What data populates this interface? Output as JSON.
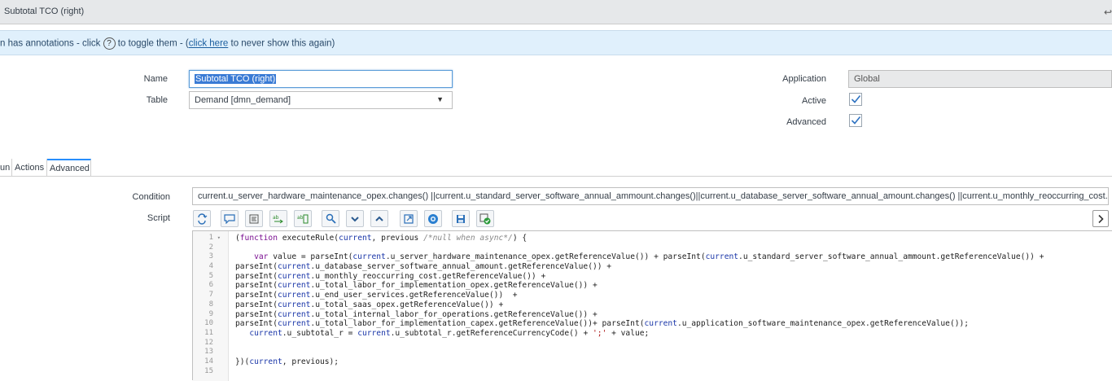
{
  "header": {
    "title": "Subtotal TCO (right)",
    "back_icon": "back-arrow-icon"
  },
  "banner": {
    "text_prefix": "n has annotations - click",
    "text_middle": "to toggle them - (",
    "link_text": "click here",
    "text_suffix": "to never show this again)",
    "help_glyph": "?"
  },
  "form": {
    "name_label": "Name",
    "name_value": "Subtotal TCO (right)",
    "table_label": "Table",
    "table_value": "Demand [dmn_demand]",
    "application_label": "Application",
    "application_value": "Global",
    "active_label": "Active",
    "active_checked": true,
    "advanced_label": "Advanced",
    "advanced_checked": true
  },
  "tabs": [
    "un",
    "Actions",
    "Advanced"
  ],
  "active_tab": "Advanced",
  "advanced": {
    "condition_label": "Condition",
    "condition_value": "current.u_server_hardware_maintenance_opex.changes() ||current.u_standard_server_software_annual_ammount.changes()||current.u_database_server_software_annual_amount.changes() ||current.u_monthly_reoccurring_cost.changes() || currc",
    "script_label": "Script"
  },
  "toolbar": {
    "buttons": [
      "toggle-syntax-icon",
      "comment-icon",
      "format-icon",
      "replace-icon",
      "replace-all-icon",
      "search-icon",
      "collapse-down-icon",
      "expand-up-icon",
      "open-editor-icon",
      "help-icon",
      "save-icon",
      "check-script-icon"
    ]
  },
  "code": {
    "line_numbers": [
      "1",
      "2",
      "3",
      "4",
      "5",
      "6",
      "7",
      "8",
      "9",
      "10",
      "11",
      "12",
      "13",
      "14",
      "15"
    ],
    "lines": [
      "(function executeRule(current, previous /*null when async*/) {",
      "",
      "    var value = parseInt(current.u_server_hardware_maintenance_opex.getReferenceValue()) + parseInt(current.u_standard_server_software_annual_ammount.getReferenceValue()) +",
      "parseInt(current.u_database_server_software_annual_amount.getReferenceValue()) +",
      "parseInt(current.u_monthly_reoccurring_cost.getReferenceValue()) +",
      "parseInt(current.u_total_labor_for_implementation_opex.getReferenceValue()) +",
      "parseInt(current.u_end_user_services.getReferenceValue())  +",
      "parseInt(current.u_total_saas_opex.getReferenceValue()) +",
      "parseInt(current.u_total_internal_labor_for_operations.getReferenceValue()) +",
      "parseInt(current.u_total_labor_for_implementation_capex.getReferenceValue())+ parseInt(current.u_application_software_maintenance_opex.getReferenceValue());",
      "   current.u_subtotal_r = current.u_subtotal_r.getReferenceCurrencyCode() + ';' + value;",
      "",
      "",
      "})(current, previous);",
      ""
    ]
  }
}
